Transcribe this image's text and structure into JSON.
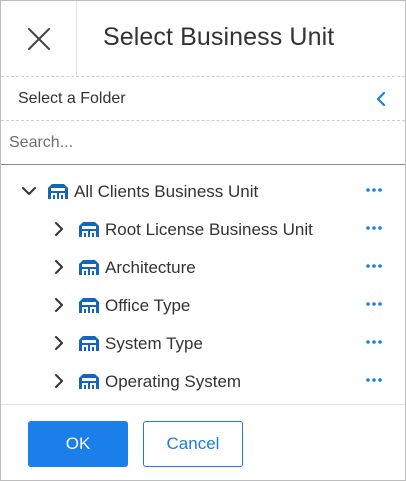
{
  "dialog": {
    "title": "Select Business Unit",
    "close_icon": "close-icon"
  },
  "folder": {
    "label": "Select a Folder",
    "back_icon": "chevron-left-icon"
  },
  "search": {
    "placeholder": "Search...",
    "value": ""
  },
  "tree": {
    "root": {
      "label": "All Clients Business Unit",
      "expanded": true,
      "icon": "business-unit-icon",
      "more_icon": "more-options-icon"
    },
    "children": [
      {
        "label": "Root License Business Unit",
        "expanded": false,
        "icon": "business-unit-icon"
      },
      {
        "label": "Architecture",
        "expanded": false,
        "icon": "business-unit-icon"
      },
      {
        "label": "Office Type",
        "expanded": false,
        "icon": "business-unit-icon"
      },
      {
        "label": "System Type",
        "expanded": false,
        "icon": "business-unit-icon"
      },
      {
        "label": "Operating System",
        "expanded": false,
        "icon": "business-unit-icon"
      }
    ]
  },
  "footer": {
    "ok_label": "OK",
    "cancel_label": "Cancel"
  },
  "colors": {
    "accent": "#1a7fe8",
    "text": "#333333",
    "icon_blue": "#1565c0"
  }
}
